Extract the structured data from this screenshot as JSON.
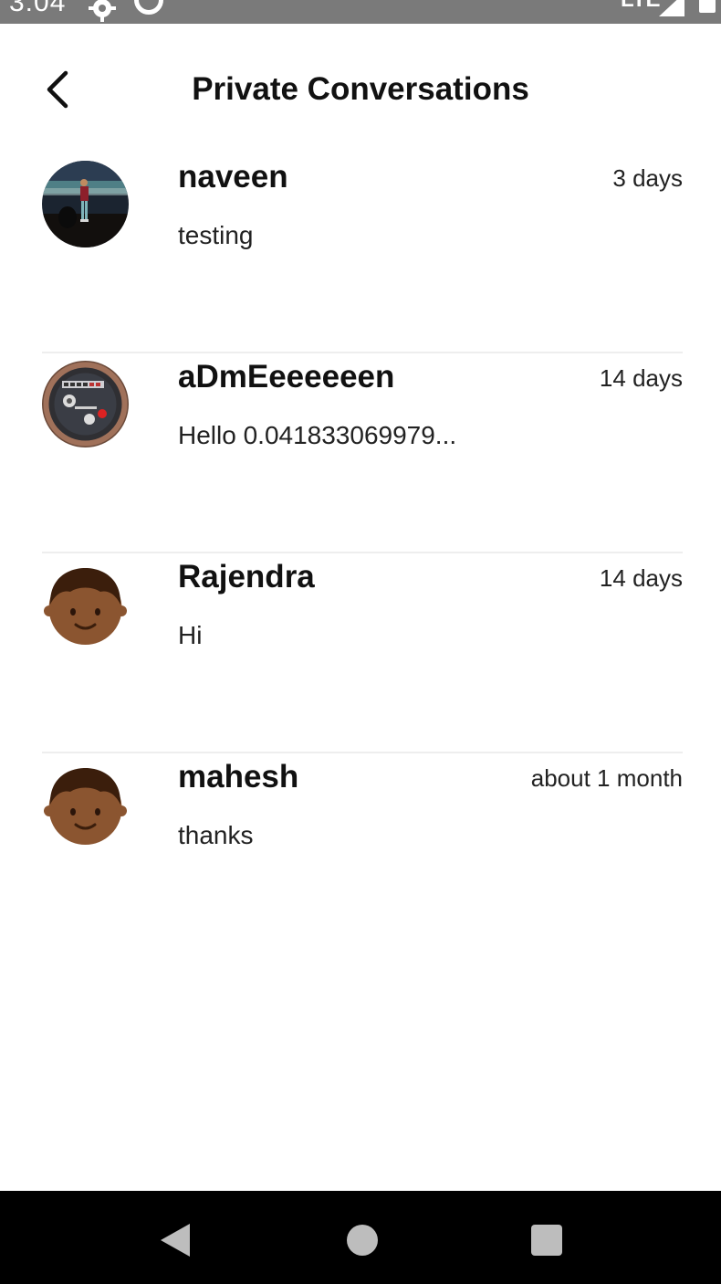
{
  "status_bar": {
    "time": "3:04",
    "network": "LTE",
    "icons": [
      "gear-icon",
      "sync-circle-icon",
      "signal-icon",
      "battery-icon"
    ]
  },
  "header": {
    "title": "Private Conversations",
    "back_icon": "chevron-left-icon"
  },
  "conversations": [
    {
      "name": "naveen",
      "time": "3 days",
      "preview": "testing",
      "avatar": "photo-person-beach"
    },
    {
      "name": "aDmEeeeeeen",
      "time": "14 days",
      "preview": "Hello 0.041833069979...",
      "avatar": "photo-meter-gauge"
    },
    {
      "name": "Rajendra",
      "time": "14 days",
      "preview": "Hi",
      "avatar": "default-face-avatar"
    },
    {
      "name": "mahesh",
      "time": "about 1 month",
      "preview": "thanks",
      "avatar": "default-face-avatar"
    }
  ],
  "nav_bar": {
    "icons": [
      "nav-back-icon",
      "nav-home-icon",
      "nav-recents-icon"
    ]
  },
  "colors": {
    "status_bar_bg": "#7a7a7a",
    "divider": "#eeeeee",
    "face_skin": "#8b5530",
    "face_hair": "#3b1e0c",
    "nav_bar_bg": "#000000"
  }
}
